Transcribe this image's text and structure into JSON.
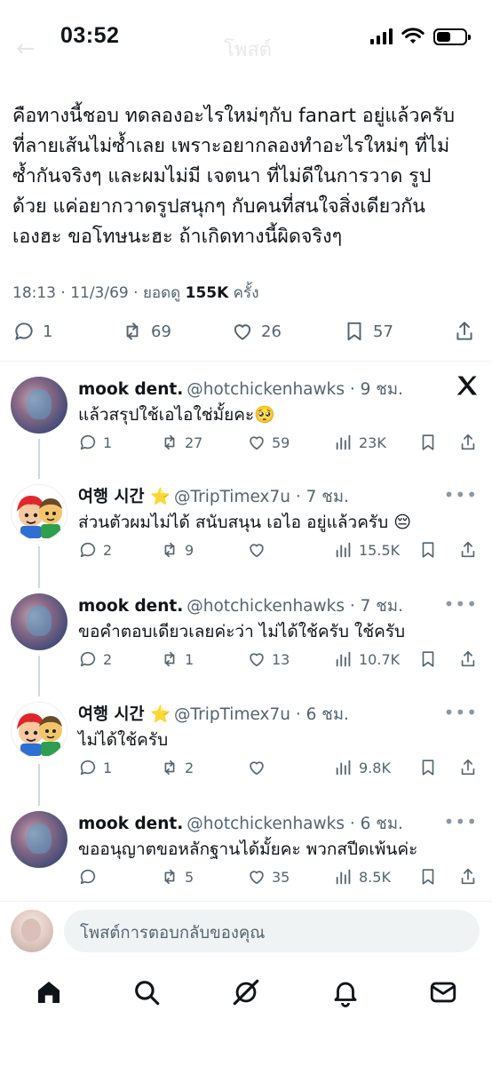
{
  "status_bar": {
    "time": "03:52",
    "header_title": "โพสต์"
  },
  "post": {
    "lines": [
      "คือทางนี้ชอบ ทดลองอะไรใหม่ๆกับ fanart อยู่แล้วครับ",
      "ที่ลายเส้นไม่ซ้ำเลย เพราะอยากลองทำอะไรใหม่ๆ ที่ไม่",
      "ซ้ำกันจริงๆ  และผมไม่มี เจตนา ที่ไม่ดีในการวาด รูป",
      "ด้วย แค่อยากวาดรูปสนุกๆ กับคนที่สนใจสิ่งเดียวกัน",
      "เองฮะ ขอโทษนะฮะ ถ้าเกิดทางนี้ผิดจริงๆ"
    ],
    "meta_prefix": "18:13 · 11/3/69 · ยอดดู ",
    "views": "155K",
    "meta_suffix": " ครั้ง",
    "replies": "1",
    "reposts": "69",
    "likes": "26",
    "bookmarks": "57"
  },
  "replies": [
    {
      "name": "mook dent.",
      "handle": "@hotchickenhawks",
      "time": "· 9 ชม.",
      "text": "แล้วสรุปใช้เอไอใช่มั้ยคะ🥺",
      "reply_count": "1",
      "repost_count": "27",
      "like_count": "59",
      "view_count": "23K",
      "avatar": "mook",
      "corner": "x-logo-icon"
    },
    {
      "name": "여행 시간 ⭐",
      "handle": "@TripTimex7u",
      "time": "· 7 ชม.",
      "text": "ส่วนตัวผมไม่ได้ สนับสนุน เอไอ อยู่แล้วครับ 😔",
      "reply_count": "2",
      "repost_count": "9",
      "like_count": "",
      "view_count": "15.5K",
      "avatar": "trip",
      "corner": "more-icon"
    },
    {
      "name": "mook dent.",
      "handle": "@hotchickenhawks",
      "time": "· 7 ชม.",
      "text": "ขอคำตอบเดียวเลยค่ะว่า ไม่ได้ใช้ครับ ใช้ครับ",
      "reply_count": "2",
      "repost_count": "1",
      "like_count": "13",
      "view_count": "10.7K",
      "avatar": "mook",
      "corner": "more-icon"
    },
    {
      "name": "여행 시간 ⭐",
      "handle": "@TripTimex7u",
      "time": "· 6 ชม.",
      "text": "ไม่ได้ใช้ครับ",
      "reply_count": "1",
      "repost_count": "2",
      "like_count": "",
      "view_count": "9.8K",
      "avatar": "trip",
      "corner": "more-icon"
    },
    {
      "name": "mook dent.",
      "handle": "@hotchickenhawks",
      "time": "· 6 ชม.",
      "text": "ขออนุญาตขอหลักฐานได้มั้ยคะ พวกสปีดเพ้นค่ะ",
      "reply_count": "",
      "repost_count": "5",
      "like_count": "35",
      "view_count": "8.5K",
      "avatar": "mook",
      "corner": "more-icon"
    }
  ],
  "composer": {
    "placeholder": "โพสต์การตอบกลับของคุณ"
  },
  "tabs": [
    "home-icon",
    "search-icon",
    "grok-icon",
    "notifications-icon",
    "messages-icon"
  ],
  "colors": {
    "text": "#0f1419",
    "secondary": "#536471",
    "divider": "#eff3f4",
    "input_bg": "#eff3f4"
  }
}
